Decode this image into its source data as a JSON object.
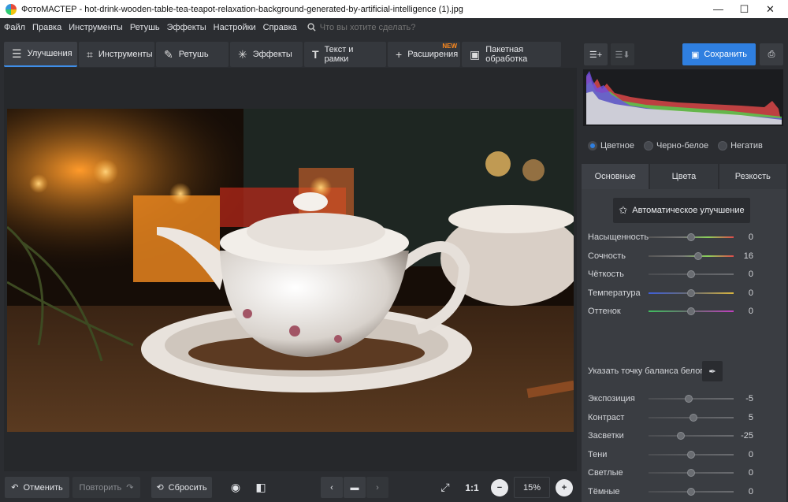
{
  "window": {
    "title": "ФотоМАСТЕР - hot-drink-wooden-table-tea-teapot-relaxation-background-generated-by-artificial-intelligence (1).jpg",
    "minimize": "—",
    "maximize": "☐",
    "close": "✕"
  },
  "menu": {
    "items": [
      "Файл",
      "Правка",
      "Инструменты",
      "Ретушь",
      "Эффекты",
      "Настройки",
      "Справка"
    ],
    "search_placeholder": "Что вы хотите сделать?"
  },
  "tabs": [
    {
      "label": "Улучшения",
      "icon": "sliders-icon"
    },
    {
      "label": "Инструменты",
      "icon": "crop-icon"
    },
    {
      "label": "Ретушь",
      "icon": "brush-icon"
    },
    {
      "label": "Эффекты",
      "icon": "magic-wand-icon"
    },
    {
      "label": "Текст и рамки",
      "icon": "text-icon"
    },
    {
      "label": "Расширения",
      "icon": "plus-icon",
      "badge": "NEW"
    },
    {
      "label": "Пакетная обработка",
      "icon": "image-icon"
    }
  ],
  "bottom": {
    "undo": "Отменить",
    "redo": "Повторить",
    "reset": "Сбросить",
    "one_to_one": "1:1",
    "zoom": "15%",
    "zoom_out": "−",
    "zoom_in": "+"
  },
  "right": {
    "save": "Сохранить",
    "color_modes": [
      "Цветное",
      "Черно-белое",
      "Негатив"
    ],
    "subtabs": [
      "Основные",
      "Цвета",
      "Резкость"
    ],
    "auto_button": "Автоматическое улучшение",
    "white_balance_label": "Указать точку баланса белого",
    "sliders_top": [
      {
        "label": "Насыщенность",
        "value": "0",
        "level": 0.5,
        "gradient": "linear-gradient(90deg,#555,#777 40%,#8bd15a 70%,#e04b4b)"
      },
      {
        "label": "Сочность",
        "value": "16",
        "level": 0.58,
        "gradient": "linear-gradient(90deg,#555,#777 40%,#8bd15a 70%,#e04b4b)"
      },
      {
        "label": "Чёткость",
        "value": "0",
        "level": 0.5,
        "gradient": "linear-gradient(90deg,#4a4c50,#6a6c70)"
      },
      {
        "label": "Температура",
        "value": "0",
        "level": 0.5,
        "gradient": "linear-gradient(90deg,#3f5fd9,#6a6c70 50%,#d9b53f)"
      },
      {
        "label": "Оттенок",
        "value": "0",
        "level": 0.5,
        "gradient": "linear-gradient(90deg,#3fbf5f,#6a6c70 50%,#c03fbf)"
      }
    ],
    "sliders_bottom": [
      {
        "label": "Экспозиция",
        "value": "-5",
        "level": 0.47
      },
      {
        "label": "Контраст",
        "value": "5",
        "level": 0.53
      },
      {
        "label": "Засветки",
        "value": "-25",
        "level": 0.38
      },
      {
        "label": "Тени",
        "value": "0",
        "level": 0.5
      },
      {
        "label": "Светлые",
        "value": "0",
        "level": 0.5
      },
      {
        "label": "Тёмные",
        "value": "0",
        "level": 0.5
      }
    ]
  },
  "colors": {
    "accent": "#2f7fe0",
    "new_badge": "#ff8a1d"
  }
}
